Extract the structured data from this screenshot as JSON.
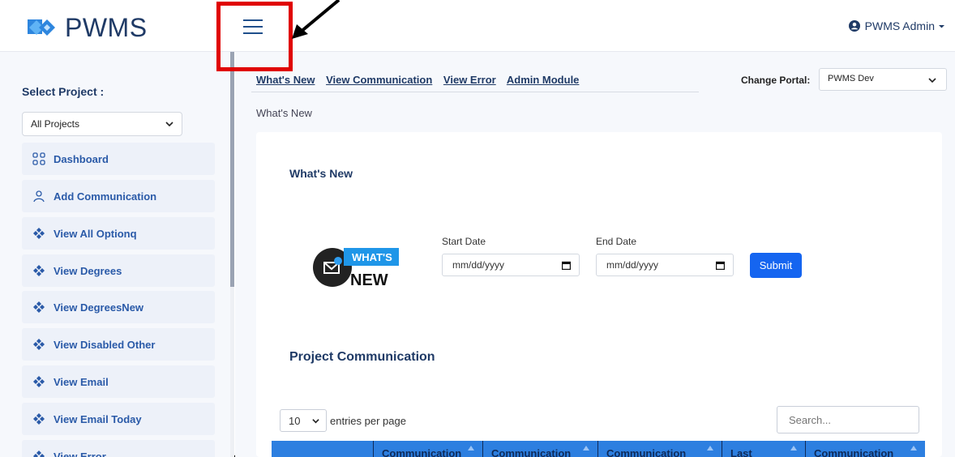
{
  "app": {
    "name": "PWMS"
  },
  "header": {
    "user_label": "PWMS Admin"
  },
  "sidebar": {
    "select_label": "Select Project :",
    "project_value": "All Projects",
    "items": [
      {
        "label": "Dashboard",
        "icon": "grid-icon"
      },
      {
        "label": "Add Communication",
        "icon": "user-icon"
      },
      {
        "label": "View All Optionq",
        "icon": "diamond-icon"
      },
      {
        "label": "View Degrees",
        "icon": "diamond-icon"
      },
      {
        "label": "View DegreesNew",
        "icon": "diamond-icon"
      },
      {
        "label": "View Disabled Other",
        "icon": "diamond-icon"
      },
      {
        "label": "View Email",
        "icon": "diamond-icon"
      },
      {
        "label": "View Email Today",
        "icon": "diamond-icon"
      },
      {
        "label": "View Error",
        "icon": "diamond-icon"
      }
    ]
  },
  "top_links": [
    "What's New",
    "View Communication",
    "View Error",
    "Admin Module"
  ],
  "portal": {
    "label": "Change Portal:",
    "value": "PWMS Dev"
  },
  "breadcrumb": "What's New",
  "card": {
    "title": "What's New",
    "image_text": {
      "line1": "WHAT'S",
      "line2": "NEW"
    },
    "start_label": "Start Date",
    "start_placeholder": "mm/dd/yyyy",
    "end_label": "End Date",
    "end_placeholder": "mm/dd/yyyy",
    "submit": "Submit"
  },
  "communication": {
    "title": "Project Communication",
    "entries_value": "10",
    "entries_suffix": "entries per page",
    "search_placeholder": "Search...",
    "columns": [
      "",
      "Communication",
      "Communication",
      "Communication",
      "Last",
      "Communication"
    ]
  },
  "colors": {
    "accent": "#1565f0",
    "brand": "#1f3a66",
    "table_header": "#2d7fe0",
    "highlight": "#e00000"
  }
}
